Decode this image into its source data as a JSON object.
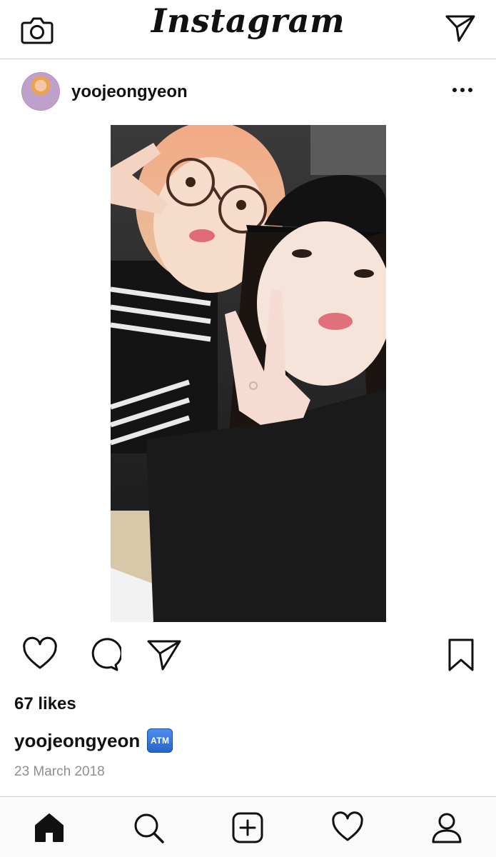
{
  "header": {
    "logo_text": "Instagram",
    "icons": [
      "camera-icon",
      "direct-message-icon"
    ]
  },
  "post": {
    "username": "yoojeongyeon",
    "avatar": "avatar-photo",
    "more_icon": "more-options-icon",
    "photo": "photo of two girls posing with peace signs",
    "likes": "67 likes",
    "caption_username": "yoojeongyeon",
    "caption_emoji": "ATM",
    "date": "23 March 2018"
  },
  "actions": {
    "icons": [
      "heart-icon",
      "comment-icon",
      "share-icon",
      "bookmark-icon"
    ]
  },
  "tabbar": {
    "icons": [
      "home-icon",
      "search-icon",
      "add-post-icon",
      "activity-heart-icon",
      "profile-icon"
    ]
  },
  "colors": {
    "text": "#111111",
    "muted": "#8e8e8e",
    "divider": "#cfcfcf",
    "atm_badge": "#2f74e0"
  }
}
